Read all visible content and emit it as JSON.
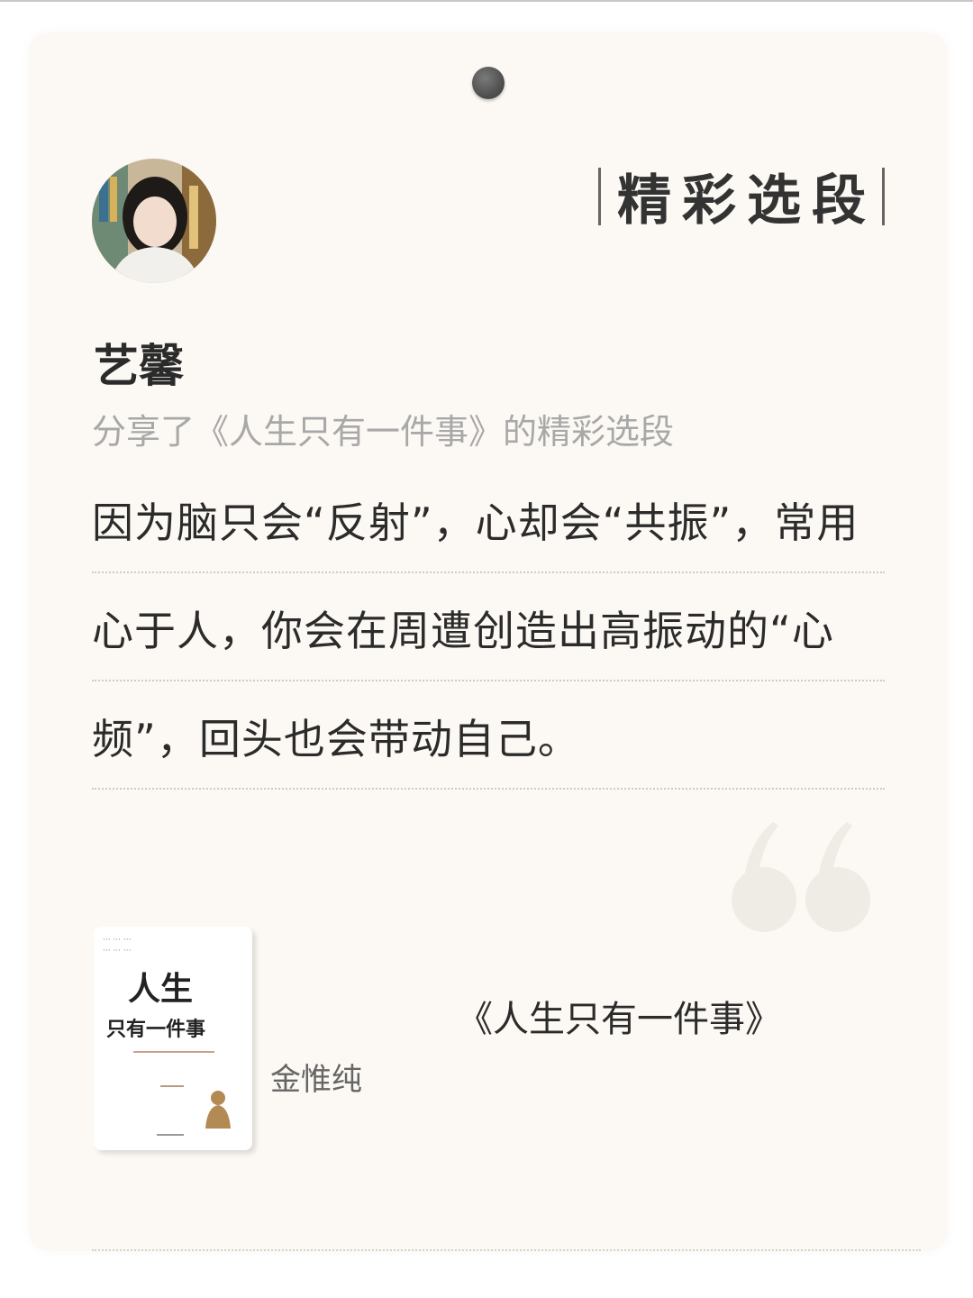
{
  "header": {
    "section_title": "精彩选段"
  },
  "user": {
    "name": "艺馨",
    "share_text": "分享了《人生只有一件事》的精彩选段"
  },
  "excerpt": {
    "lines": [
      "因为脑只会“反射”，心却会“共振”，常用",
      "心于人，你会在周遭创造出高振动的“心",
      "频”，回头也会带动自己。"
    ]
  },
  "book": {
    "title": "《人生只有一件事》",
    "author": "金惟纯",
    "cover_title": "人生",
    "cover_subtitle": "只有一件事"
  },
  "icons": {
    "pin": "pin-icon",
    "quote": "quote-mark-icon"
  },
  "colors": {
    "card_background": "#fcf9f4",
    "text_primary": "#2b2b2b",
    "text_muted": "#a8a8a8"
  }
}
